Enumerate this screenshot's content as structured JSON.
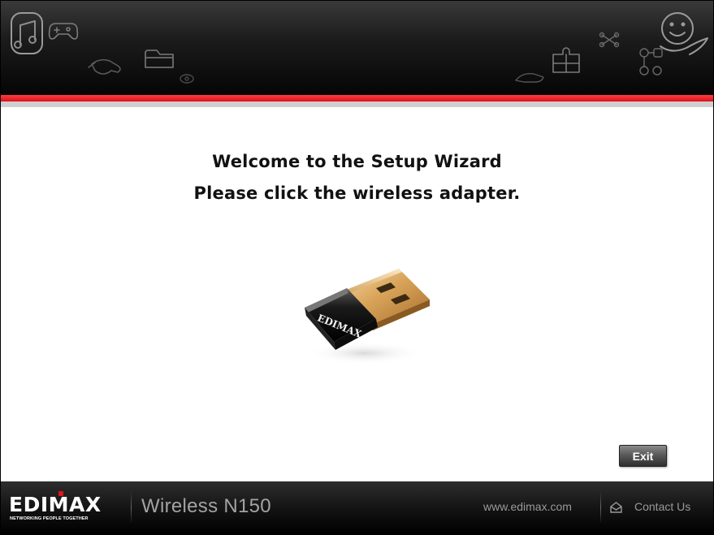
{
  "header": {
    "decorative_icons": [
      "music-note-icon",
      "gamepad-icon",
      "handshake-icon",
      "folder-icon",
      "eye-icon",
      "hand-icon",
      "puzzle-icon",
      "network-icon",
      "smiley-hand-icon"
    ]
  },
  "main": {
    "title_line1": "Welcome to the Setup Wizard",
    "title_line2": "Please click the wireless adapter.",
    "adapter_brand": "EDIMAX",
    "exit_label": "Exit"
  },
  "footer": {
    "brand": "EDIMAX",
    "tagline": "NETWORKING PEOPLE TOGETHER",
    "product": "Wireless N150",
    "website": "www.edimax.com",
    "contact_label": "Contact Us"
  },
  "colors": {
    "accent_red": "#d8141c",
    "header_dark": "#050505",
    "footer_text": "#9a9a9a"
  }
}
